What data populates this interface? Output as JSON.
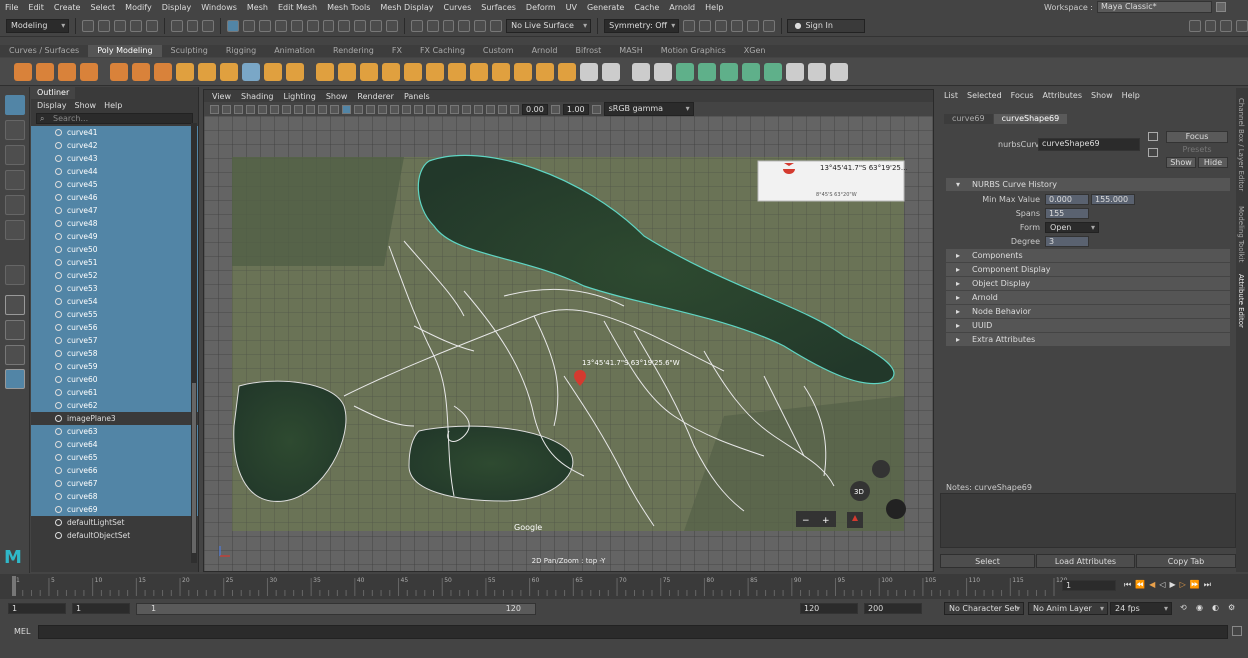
{
  "menubar": [
    "File",
    "Edit",
    "Create",
    "Select",
    "Modify",
    "Display",
    "Windows",
    "Mesh",
    "Edit Mesh",
    "Mesh Tools",
    "Mesh Display",
    "Curves",
    "Surfaces",
    "Deform",
    "UV",
    "Generate",
    "Cache",
    "Arnold",
    "Help"
  ],
  "workspace": {
    "label": "Workspace :",
    "value": "Maya Classic*"
  },
  "status": {
    "mode": "Modeling",
    "live_surface": "No Live Surface",
    "symmetry": "Symmetry: Off",
    "signin": "Sign In"
  },
  "shelf_tabs": [
    "Curves / Surfaces",
    "Poly Modeling",
    "Sculpting",
    "Rigging",
    "Animation",
    "Rendering",
    "FX",
    "FX Caching",
    "Custom",
    "Arnold",
    "Bifrost",
    "MASH",
    "Motion Graphics",
    "XGen"
  ],
  "shelf_active": "Poly Modeling",
  "outliner": {
    "tab": "Outliner",
    "menu": [
      "Display",
      "Show",
      "Help"
    ],
    "search_placeholder": "Search...",
    "rows": [
      {
        "label": "curve41",
        "kind": "sel"
      },
      {
        "label": "curve42",
        "kind": "sel"
      },
      {
        "label": "curve43",
        "kind": "sel"
      },
      {
        "label": "curve44",
        "kind": "sel"
      },
      {
        "label": "curve45",
        "kind": "sel"
      },
      {
        "label": "curve46",
        "kind": "sel"
      },
      {
        "label": "curve47",
        "kind": "sel"
      },
      {
        "label": "curve48",
        "kind": "sel"
      },
      {
        "label": "curve49",
        "kind": "sel"
      },
      {
        "label": "curve50",
        "kind": "sel"
      },
      {
        "label": "curve51",
        "kind": "sel"
      },
      {
        "label": "curve52",
        "kind": "sel"
      },
      {
        "label": "curve53",
        "kind": "sel"
      },
      {
        "label": "curve54",
        "kind": "sel"
      },
      {
        "label": "curve55",
        "kind": "sel"
      },
      {
        "label": "curve56",
        "kind": "sel"
      },
      {
        "label": "curve57",
        "kind": "sel"
      },
      {
        "label": "curve58",
        "kind": "sel"
      },
      {
        "label": "curve59",
        "kind": "sel"
      },
      {
        "label": "curve60",
        "kind": "sel"
      },
      {
        "label": "curve61",
        "kind": "sel"
      },
      {
        "label": "curve62",
        "kind": "sel"
      },
      {
        "label": "imagePlane3",
        "kind": "img"
      },
      {
        "label": "curve63",
        "kind": "sel"
      },
      {
        "label": "curve64",
        "kind": "sel"
      },
      {
        "label": "curve65",
        "kind": "sel"
      },
      {
        "label": "curve66",
        "kind": "sel"
      },
      {
        "label": "curve67",
        "kind": "sel"
      },
      {
        "label": "curve68",
        "kind": "sel"
      },
      {
        "label": "curve69",
        "kind": "sel"
      },
      {
        "label": "defaultLightSet",
        "kind": "set"
      },
      {
        "label": "defaultObjectSet",
        "kind": "set"
      }
    ]
  },
  "viewport": {
    "menu": [
      "View",
      "Shading",
      "Lighting",
      "Show",
      "Renderer",
      "Panels"
    ],
    "val1": "0.00",
    "val2": "1.00",
    "colorspace": "sRGB gamma",
    "label": "2D Pan/Zoom : top -Y",
    "map_coord_top": "13°45'41.7\"S 63°19'25...",
    "map_coord_sub": "8°45'S 63°20\"W",
    "map_coord_mid": "13°45'41.7\"S 63°19'25.6\"W",
    "map_3d": "3D",
    "map_logo": "Google"
  },
  "attr": {
    "menu": [
      "List",
      "Selected",
      "Focus",
      "Attributes",
      "Show",
      "Help"
    ],
    "tabs": [
      "curve69",
      "curveShape69"
    ],
    "type_label": "nurbsCurve:",
    "type_value": "curveShape69",
    "focus": "Focus",
    "presets": "Presets",
    "show": "Show",
    "hide": "Hide",
    "history_title": "NURBS Curve History",
    "minmax_label": "Min Max Value",
    "min": "0.000",
    "max": "155.000",
    "spans_label": "Spans",
    "spans": "155",
    "form_label": "Form",
    "form": "Open",
    "degree_label": "Degree",
    "degree": "3",
    "sections": [
      "Components",
      "Component Display",
      "Object Display",
      "Arnold",
      "Node Behavior",
      "UUID",
      "Extra Attributes"
    ],
    "notes": "Notes:  curveShape69",
    "btn_select": "Select",
    "btn_load": "Load Attributes",
    "btn_copy": "Copy Tab"
  },
  "right_tabs": [
    "Channel Box / Layer Editor",
    "Modeling Toolkit",
    "Attribute Editor"
  ],
  "timeline": {
    "ticks": [
      "1",
      "5",
      "10",
      "15",
      "20",
      "25",
      "30",
      "35",
      "40",
      "45",
      "50",
      "55",
      "60",
      "65",
      "70",
      "75",
      "80",
      "85",
      "90",
      "95",
      "100",
      "105",
      "110",
      "115",
      "120"
    ],
    "current": "1"
  },
  "range": {
    "start": "1",
    "anim_start": "1",
    "slider_start": "1",
    "slider_end": "120",
    "end": "120",
    "anim_end": "200",
    "character": "No Character Set",
    "anim_layer": "No Anim Layer",
    "fps": "24 fps"
  },
  "cmd": {
    "label": "MEL"
  }
}
